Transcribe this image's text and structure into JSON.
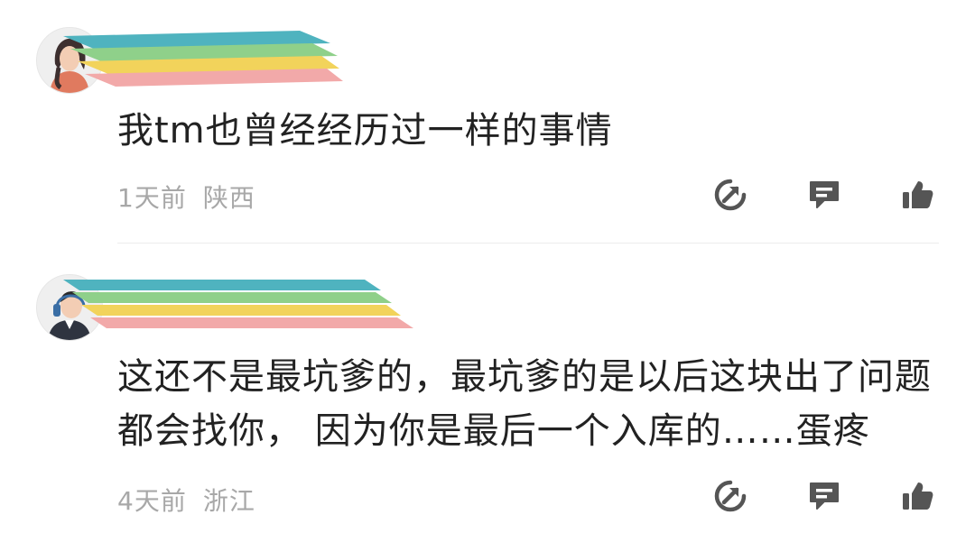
{
  "comments": [
    {
      "text": "我tm也曾经经历过一样的事情",
      "time": "1天前",
      "location": "陕西"
    },
    {
      "text": "这还不是最坑爹的，最坑爹的是以后这块出了问题都会找你， 因为你是最后一个入库的……蛋疼",
      "time": "4天前",
      "location": "浙江"
    }
  ],
  "icons": {
    "share": "share-arrow-icon",
    "reply": "comment-bubble-icon",
    "like": "thumbs-up-icon"
  },
  "colors": {
    "text": "#222222",
    "meta": "#a8a8a8",
    "icon": "#555555",
    "redaction": [
      "#4fb3bf",
      "#8fd08a",
      "#f2d35b",
      "#f2a9a9"
    ]
  }
}
